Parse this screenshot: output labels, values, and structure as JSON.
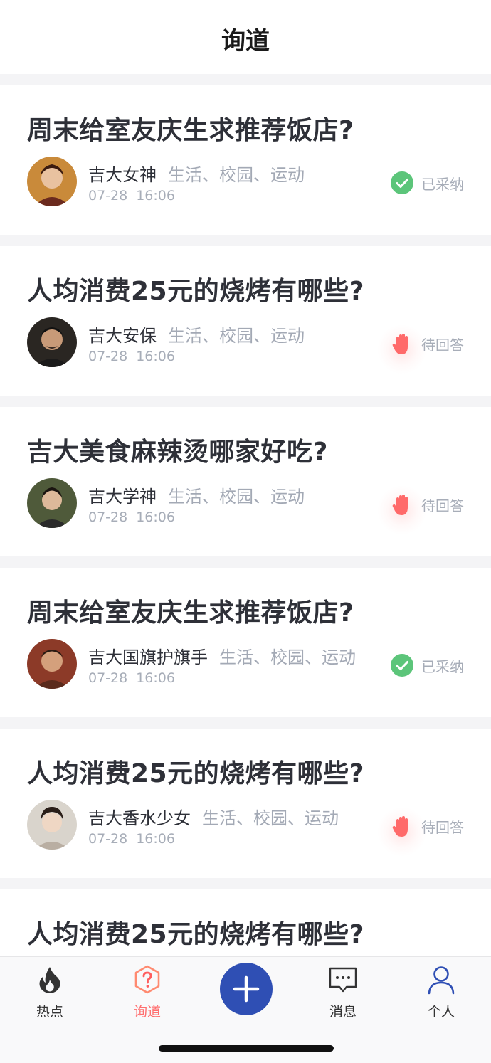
{
  "header": {
    "title": "询道"
  },
  "questions": [
    {
      "title": "周末给室友庆生求推荐饭店?",
      "author": "吉大女神",
      "tags": "生活、校园、运动",
      "date": "07-28",
      "time": "16:06",
      "status": "已采纳",
      "status_icon": "check-circle-icon"
    },
    {
      "title": "人均消费25元的烧烤有哪些?",
      "author": "吉大安保",
      "tags": "生活、校园、运动",
      "date": "07-28",
      "time": "16:06",
      "status": "待回答",
      "status_icon": "raised-hand-icon"
    },
    {
      "title": "吉大美食麻辣烫哪家好吃?",
      "author": "吉大学神",
      "tags": "生活、校园、运动",
      "date": "07-28",
      "time": "16:06",
      "status": "待回答",
      "status_icon": "raised-hand-icon"
    },
    {
      "title": "周末给室友庆生求推荐饭店?",
      "author": "吉大国旗护旗手",
      "tags": "生活、校园、运动",
      "date": "07-28",
      "time": "16:06",
      "status": "已采纳",
      "status_icon": "check-circle-icon"
    },
    {
      "title": "人均消费25元的烧烤有哪些?",
      "author": "吉大香水少女",
      "tags": "生活、校园、运动",
      "date": "07-28",
      "time": "16:06",
      "status": "待回答",
      "status_icon": "raised-hand-icon"
    },
    {
      "title": "人均消费25元的烧烤有哪些?"
    }
  ],
  "bottom_nav": {
    "items": [
      {
        "label": "热点",
        "icon": "flame-icon"
      },
      {
        "label": "询道",
        "icon": "question-hexagon-icon",
        "active": true
      },
      {
        "label": "",
        "icon": "plus-icon"
      },
      {
        "label": "消息",
        "icon": "message-icon"
      },
      {
        "label": "个人",
        "icon": "person-icon"
      }
    ]
  },
  "colors": {
    "accent": "#2f4fb4",
    "active": "#ff6f6f",
    "check": "#5cc57a",
    "hand": "#ff6a6a",
    "muted": "#a7adb8"
  }
}
